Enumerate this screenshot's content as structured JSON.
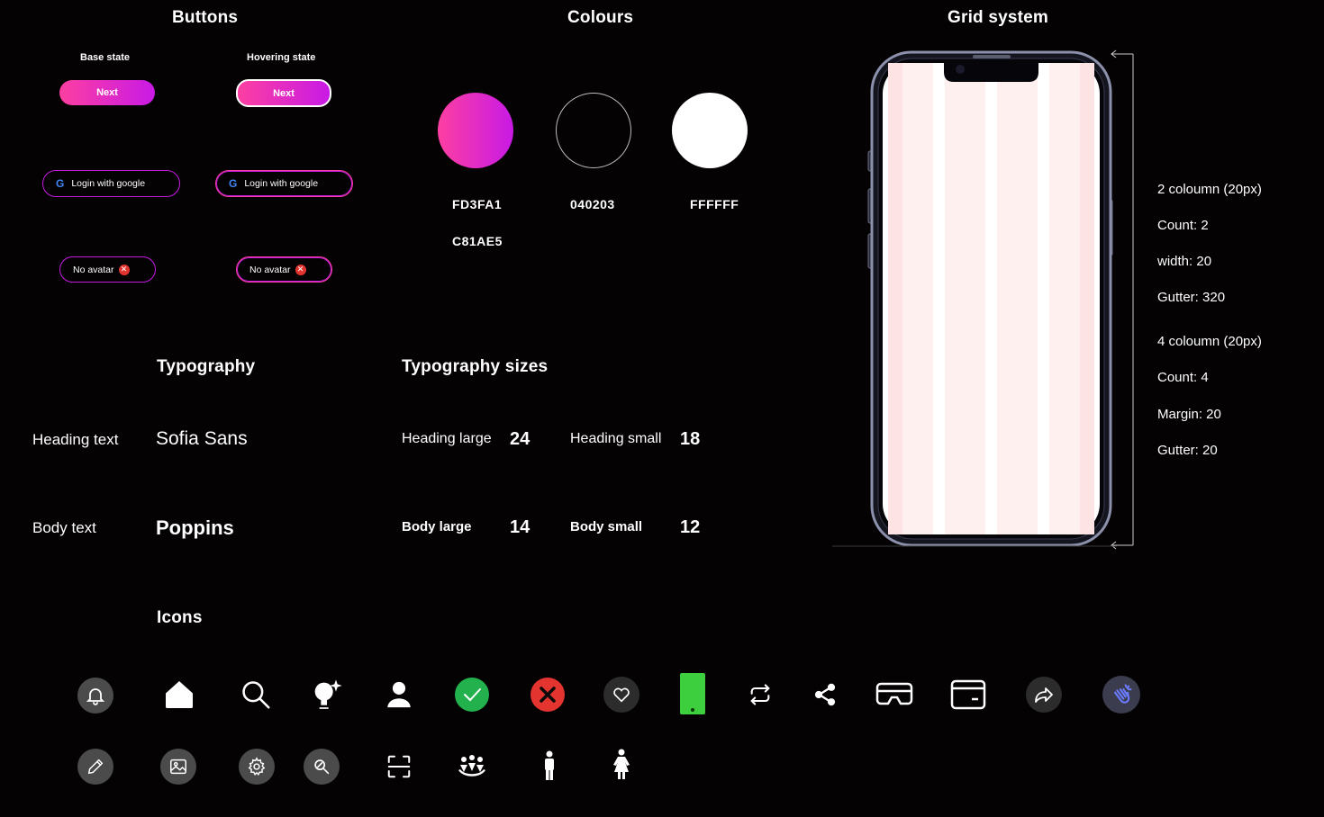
{
  "buttons": {
    "title": "Buttons",
    "base_state": "Base state",
    "hover_state": "Hovering state",
    "next_label": "Next",
    "google_label": "Login with google",
    "google_logo": "G",
    "no_avatar_label": "No avatar"
  },
  "colours": {
    "title": "Colours",
    "swatches": [
      {
        "hex": "FD3FA1",
        "color": "#FD3FA1"
      },
      {
        "hex": "040203",
        "color": "#040203"
      },
      {
        "hex": "FFFFFF",
        "color": "#FFFFFF"
      }
    ],
    "secondary_hex": "C81AE5",
    "secondary_color": "#C81AE5"
  },
  "grid": {
    "title": "Grid system",
    "two_col_title": "2 coloumn (20px)",
    "two_col_count": "Count: 2",
    "two_col_width": "width: 20",
    "two_col_gutter": "Gutter: 320",
    "four_col_title": "4 coloumn (20px)",
    "four_col_count": "Count: 4",
    "four_col_margin": "Margin: 20",
    "four_col_gutter": "Gutter: 20"
  },
  "typography": {
    "title": "Typography",
    "heading_label": "Heading text",
    "heading_font": "Sofia Sans",
    "body_label": "Body text",
    "body_font": "Poppins"
  },
  "sizes": {
    "title": "Typography sizes",
    "heading_large_label": "Heading large",
    "heading_large_value": "24",
    "heading_small_label": "Heading small",
    "heading_small_value": "18",
    "body_large_label": "Body large",
    "body_large_value": "14",
    "body_small_label": "Body small",
    "body_small_value": "12"
  },
  "icons": {
    "title": "Icons",
    "row1": [
      "bell-icon",
      "home-icon",
      "search-icon",
      "idea-icon",
      "user-icon",
      "check-icon",
      "close-icon",
      "heart-icon",
      "phone-icon",
      "repeat-icon",
      "share-icon",
      "vr-headset-icon",
      "wallet-icon",
      "forward-icon",
      "clap-icon"
    ],
    "row2": [
      "edit-icon",
      "image-icon",
      "settings-icon",
      "search-tool-icon",
      "scan-icon",
      "community-icon",
      "male-icon",
      "female-icon"
    ]
  },
  "accents": {
    "green": "#22b14c",
    "red": "#e3342f",
    "phone_green": "#3ecf3e"
  }
}
